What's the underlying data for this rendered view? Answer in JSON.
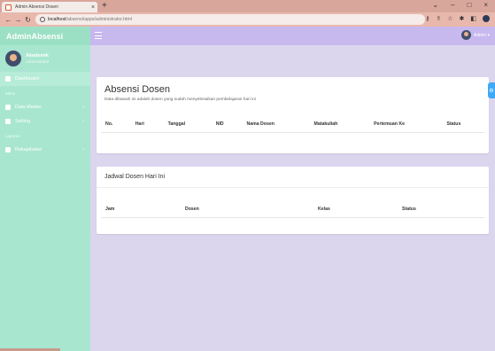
{
  "browser": {
    "tab_title": "Admin Absensi Dosen",
    "tab_close": "×",
    "new_tab": "+",
    "url_host": "localhost",
    "url_path": "/absensi/apps/administrator.html",
    "win_min": "–",
    "win_max": "□",
    "win_close": "×"
  },
  "sidebar": {
    "brand": "AdminAbsensi",
    "user_name": "Akademik",
    "user_role": "Administrator",
    "header_main": "Menu",
    "items": [
      {
        "label": "Dashboard",
        "icon": "dashboard-icon"
      },
      {
        "label": "Data Master",
        "icon": "book-icon"
      },
      {
        "label": "Setting",
        "icon": "cogs-icon"
      }
    ],
    "header_report": "Laporan",
    "report_item": {
      "label": "Rekapitulasi",
      "icon": "file-icon"
    }
  },
  "topnav": {
    "admin_label": "Admin ▾"
  },
  "absensi": {
    "title": "Absensi Dosen",
    "subtitle": "Data dibawah ini adalah dosen yang sudah menyelesaikan pembelajaran hari ini",
    "columns": [
      "No.",
      "Hari",
      "Tanggal",
      "NID",
      "Nama Dosen",
      "Matakuliah",
      "Pertemuan Ke",
      "Status"
    ]
  },
  "jadwal": {
    "title": "Jadwal Dosen Hari Ini",
    "columns": [
      "Jam",
      "Dosen",
      "Kelas",
      "Status"
    ]
  },
  "colors": {
    "sidebar": "#a8e6d0",
    "topnav": "#c7b8ee",
    "content_bg": "#dcd5ee",
    "accent": "#3fa9f5"
  }
}
